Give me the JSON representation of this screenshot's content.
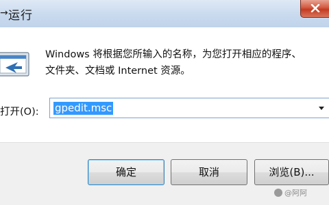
{
  "window": {
    "title_glyph": "→",
    "title": "运行"
  },
  "content": {
    "description_line1": "Windows 将根据您所输入的名称，为您打开相应的程序、",
    "description_line2": "文件夹、文档或 Internet 资源。",
    "open_label": "打开(O):",
    "open_value": "gpedit.msc"
  },
  "buttons": {
    "ok": "确定",
    "cancel": "取消",
    "browse": "浏览(B)..."
  },
  "watermark": {
    "text": "@阿阿"
  },
  "colors": {
    "accent": "#3399ff",
    "close_button": "#c23b22"
  }
}
